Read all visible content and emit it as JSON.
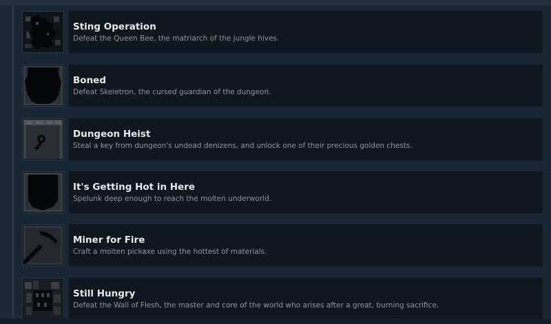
{
  "achievements": [
    {
      "title": "Sting Operation",
      "description": "Defeat the Queen Bee, the matriarch of the jungle hives.",
      "icon": "queen-bee-icon"
    },
    {
      "title": "Boned",
      "description": "Defeat Skeletron, the cursed guardian of the dungeon.",
      "icon": "skeletron-icon"
    },
    {
      "title": "Dungeon Heist",
      "description": "Steal a key from dungeon's undead denizens, and unlock one of their precious golden chests.",
      "icon": "key-icon"
    },
    {
      "title": "It's Getting Hot in Here",
      "description": "Spelunk deep enough to reach the molten underworld.",
      "icon": "underworld-icon"
    },
    {
      "title": "Miner for Fire",
      "description": "Craft a molten pickaxe using the hottest of materials.",
      "icon": "pickaxe-icon"
    },
    {
      "title": "Still Hungry",
      "description": "Defeat the Wall of Flesh, the master and core of the world who arises after a great, burning sacrifice.",
      "icon": "wall-of-flesh-icon"
    }
  ]
}
